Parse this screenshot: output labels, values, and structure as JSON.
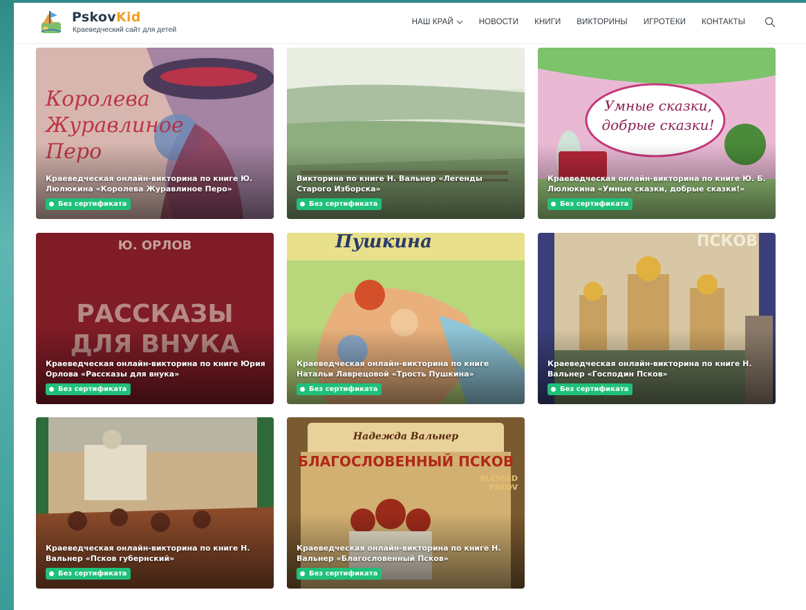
{
  "brand": {
    "name_part1": "Pskov",
    "name_part2": "Kid",
    "tagline": "Краеведческий сайт для детей",
    "accent_color": "#f0a020"
  },
  "nav": {
    "items": [
      {
        "label": "НАШ КРАЙ",
        "has_dropdown": true
      },
      {
        "label": "НОВОСТИ"
      },
      {
        "label": "КНИГИ"
      },
      {
        "label": "ВИКТОРИНЫ"
      },
      {
        "label": "ИГРОТЕКИ"
      },
      {
        "label": "КОНТАКТЫ"
      }
    ],
    "search_icon": "search-icon"
  },
  "badge_color": "#1fc07a",
  "cards": [
    {
      "title": "Краеведческая онлайн-викторина по книге Ю. Люлюкина «Королева Журавлиное Перо»",
      "badge": "Без сертификата",
      "cover_text": "Королева Журавлиное Перо"
    },
    {
      "title": "Викторина по книге Н. Вальнер «Легенды Старого Изборска»",
      "badge": "Без сертификата"
    },
    {
      "title": "Краеведческая онлайн-викторина по книге Ю. Б. Люлюкина «Умные сказки, добрые сказки!»",
      "badge": "Без сертификата",
      "cover_text": "Умные сказки, добрые сказки!"
    },
    {
      "title": "Краеведческая онлайн-викторина по книге Юрия Орлова «Рассказы для внука»",
      "badge": "Без сертификата",
      "cover_author": "Ю. ОРЛОВ",
      "cover_text": "РАССКАЗЫ ДЛЯ ВНУКА"
    },
    {
      "title": "Краеведческая онлайн-викторина по книге Натальи Лаврецовой «Трость Пушкина»",
      "badge": "Без сертификата",
      "cover_text": "Пушкина"
    },
    {
      "title": "Краеведческая онлайн-викторина по книге Н. Вальнер «Господин Псков»",
      "badge": "Без сертификата",
      "cover_text": "ПСКОВ"
    },
    {
      "title": "Краеведческая онлайн-викторина по книге Н. Вальнер «Псков губернский»",
      "badge": "Без сертификата"
    },
    {
      "title": "Краеведческая онлайн-викторина по книге Н. Вальнер «Благословенный Псков»",
      "badge": "Без сертификата",
      "cover_author": "Надежда Вальнер",
      "cover_text": "БЛАГОСЛОВЕННЫЙ ПСКОВ",
      "cover_subtext": "BLESSED PSKOV"
    }
  ]
}
